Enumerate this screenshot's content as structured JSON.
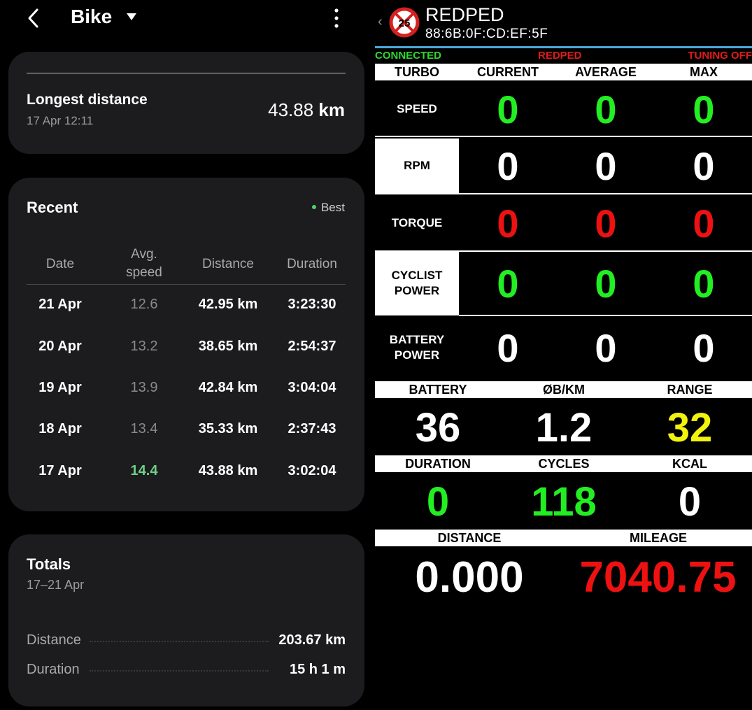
{
  "left": {
    "header": {
      "title": "Bike"
    },
    "longest": {
      "label": "Longest distance",
      "date": "17 Apr 12:11",
      "value": "43.88",
      "unit": "km"
    },
    "recent": {
      "title": "Recent",
      "best_label": "Best",
      "columns": {
        "date": "Date",
        "speed_line1": "Avg.",
        "speed_line2": "speed",
        "distance": "Distance",
        "duration": "Duration"
      },
      "rows": [
        {
          "date": "21 Apr",
          "speed": "12.6",
          "distance": "42.95 km",
          "duration": "3:23:30",
          "best": false
        },
        {
          "date": "20 Apr",
          "speed": "13.2",
          "distance": "38.65 km",
          "duration": "2:54:37",
          "best": false
        },
        {
          "date": "19 Apr",
          "speed": "13.9",
          "distance": "42.84 km",
          "duration": "3:04:04",
          "best": false
        },
        {
          "date": "18 Apr",
          "speed": "13.4",
          "distance": "35.33 km",
          "duration": "2:37:43",
          "best": false
        },
        {
          "date": "17 Apr",
          "speed": "14.4",
          "distance": "43.88 km",
          "duration": "3:02:04",
          "best": true
        }
      ]
    },
    "totals": {
      "title": "Totals",
      "range": "17–21 Apr",
      "items": [
        {
          "label": "Distance",
          "value": "203.67 km"
        },
        {
          "label": "Duration",
          "value": "15 h 1 m"
        }
      ]
    }
  },
  "right": {
    "header": {
      "back": "‹",
      "logo_number": "25",
      "title": "REDPED",
      "mac": "88:6B:0F:CD:EF:5F"
    },
    "status": {
      "connection": "CONNECTED",
      "mode": "REDPED",
      "tuning": "TUNING OFF"
    },
    "table_header": {
      "mode": "TURBO",
      "current": "CURRENT",
      "average": "AVERAGE",
      "max": "MAX"
    },
    "metrics": [
      {
        "label": "SPEED",
        "current": "0",
        "average": "0",
        "max": "0",
        "color": "#22ee22"
      },
      {
        "label": "RPM",
        "current": "0",
        "average": "0",
        "max": "0",
        "color": "#ffffff"
      },
      {
        "label": "TORQUE",
        "current": "0",
        "average": "0",
        "max": "0",
        "color": "#ee1111"
      },
      {
        "label": "CYCLIST\nPOWER",
        "current": "0",
        "average": "0",
        "max": "0",
        "color": "#22ee22"
      },
      {
        "label": "BATTERY\nPOWER",
        "current": "0",
        "average": "0",
        "max": "0",
        "color": "#ffffff"
      }
    ],
    "info1": {
      "battery_label": "BATTERY",
      "battery": "36",
      "wh_label": "ØB/KM",
      "wh": "1.2",
      "range_label": "RANGE",
      "range": "32"
    },
    "info2": {
      "duration_label": "DURATION",
      "duration": "0",
      "cycles_label": "CYCLES",
      "cycles": "118",
      "kcal_label": "KCAL",
      "kcal": "0"
    },
    "info3": {
      "distance_label": "DISTANCE",
      "distance": "0.000",
      "mileage_label": "MILEAGE",
      "mileage": "7040.75"
    },
    "colors": {
      "green": "#22ee22",
      "red": "#ee1111",
      "yellow": "#f2f20f",
      "blue_line": "#4aa8d8"
    }
  }
}
